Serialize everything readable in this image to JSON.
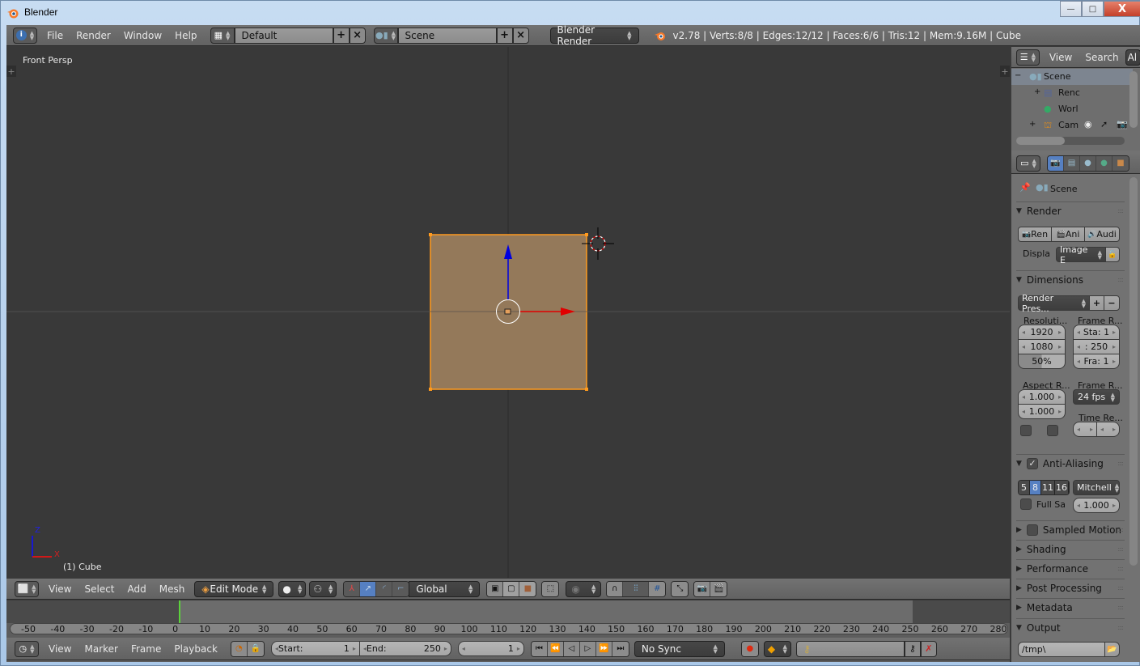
{
  "window": {
    "title": "Blender",
    "buttons": {
      "minimize": "—",
      "maximize": "□",
      "close": "X"
    }
  },
  "info_header": {
    "menus": [
      "File",
      "Render",
      "Window",
      "Help"
    ],
    "screen_layout": "Default",
    "scene": "Scene",
    "render_engine": "Blender Render",
    "stats": "v2.78 | Verts:8/8 | Edges:12/12 | Faces:6/6 | Tris:12 | Mem:9.16M | Cube"
  },
  "viewport": {
    "view_label": "Front Persp",
    "object_label": "(1) Cube",
    "axis_z": "Z",
    "axis_x": "X",
    "colors": {
      "background": "#393939",
      "face": "#94795a",
      "edge": "#ff9a1e",
      "x_axis": "#e00000",
      "z_axis": "#0000e0"
    }
  },
  "view3d_header": {
    "menus": [
      "View",
      "Select",
      "Add",
      "Mesh"
    ],
    "mode": "Edit Mode",
    "orientation": "Global"
  },
  "timeline": {
    "ticks": [
      "-50",
      "-40",
      "-30",
      "-20",
      "-10",
      "0",
      "10",
      "20",
      "30",
      "40",
      "50",
      "60",
      "70",
      "80",
      "90",
      "100",
      "110",
      "120",
      "130",
      "140",
      "150",
      "160",
      "170",
      "180",
      "190",
      "200",
      "210",
      "220",
      "230",
      "240",
      "250",
      "260",
      "270",
      "280"
    ],
    "current_frame_marker": 0,
    "menus": [
      "View",
      "Marker",
      "Frame",
      "Playback"
    ],
    "start_label": "Start:",
    "start_value": "1",
    "end_label": "End:",
    "end_value": "250",
    "current_frame": "1",
    "sync": "No Sync"
  },
  "outliner": {
    "menus": [
      "View",
      "Search"
    ],
    "filter_button": "Al",
    "items": [
      {
        "label": "Scene",
        "expand": "−"
      },
      {
        "label": "Renc",
        "expand": "+"
      },
      {
        "label": "Worl",
        "expand": ""
      },
      {
        "label": "Cam",
        "expand": "+"
      }
    ]
  },
  "properties": {
    "context": "Scene",
    "render_panel": {
      "title": "Render",
      "buttons": [
        "Ren",
        "Ani",
        "Audi"
      ],
      "display_label": "Displa",
      "display_value": "Image E"
    },
    "dimensions_panel": {
      "title": "Dimensions",
      "preset": "Render Pres...",
      "resolution_label": "Resoluti...",
      "res_x": "1920",
      "res_y": "1080",
      "res_pct": "50%",
      "res_pct_value": 0.5,
      "frame_range_label": "Frame R...",
      "frame_start": "Sta: 1",
      "frame_end": ": 250",
      "frame_step": "Fra: 1",
      "aspect_label": "Aspect R...",
      "aspect_x": "1.000",
      "aspect_y": "1.000",
      "frame_rate_label": "Frame R...",
      "frame_rate": "24 fps",
      "time_remap_label": "Time Re..."
    },
    "aa_panel": {
      "title": "Anti-Aliasing",
      "enabled": true,
      "samples": [
        "5",
        "8",
        "11",
        "16"
      ],
      "selected_sample": "8",
      "filter": "Mitchell",
      "full_sample_label": "Full Sa",
      "filter_size": "1.000"
    },
    "collapsed_panels": [
      "Sampled Motion",
      "Shading",
      "Performance",
      "Post Processing",
      "Metadata"
    ],
    "output_panel": {
      "title": "Output",
      "path": "/tmp\\"
    }
  }
}
